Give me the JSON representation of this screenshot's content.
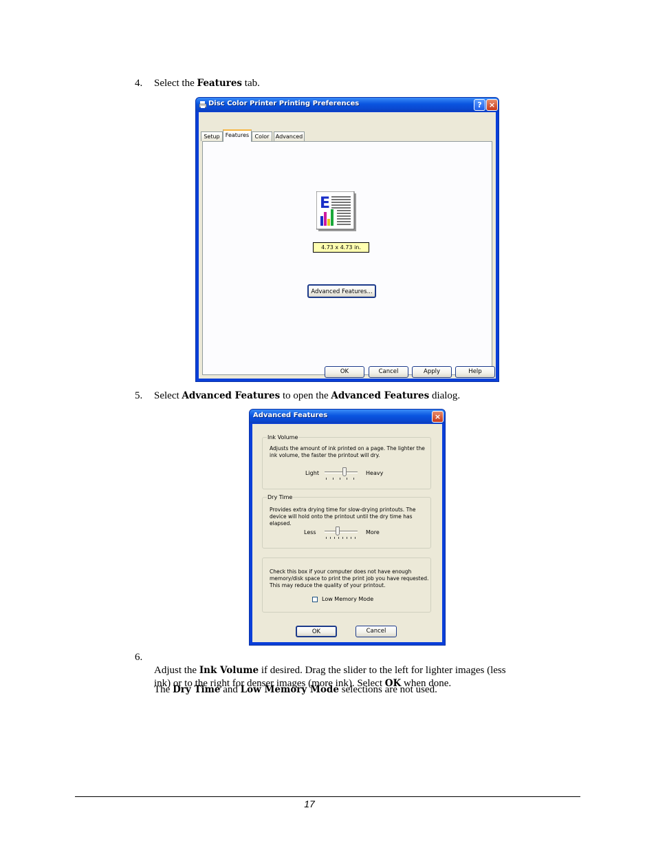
{
  "steps": {
    "s4": {
      "num": "4.",
      "pre": "Select the ",
      "bold": "Features",
      "post": " tab."
    },
    "s5": {
      "num": "5.",
      "pre": "Select ",
      "bold1": "Advanced Features",
      "mid": " to open the ",
      "bold2": "Advanced Features",
      "post": " dialog."
    },
    "s6": {
      "num": "6.",
      "pre": "Adjust the ",
      "bold1": "Ink Volume",
      "mid": " if desired. Drag the slider to the left for lighter images (less",
      "line2": "ink) or to the right for denser images (more ink).  Select ",
      "bold2": "OK",
      "post": " when done."
    },
    "note": {
      "pre": "The ",
      "bold1": "Dry Time",
      "mid": " and ",
      "bold2": "Low Memory Mode",
      "post": " selections are not used."
    }
  },
  "prefs_dialog": {
    "title": "Disc Color Printer Printing Preferences",
    "help_glyph": "?",
    "close_glyph": "×",
    "tabs": [
      "Setup",
      "Features",
      "Color",
      "Advanced"
    ],
    "size_label": "4.73 x 4.73 in.",
    "advanced_button": "Advanced Features...",
    "buttons": {
      "ok": "OK",
      "cancel": "Cancel",
      "apply": "Apply",
      "help": "Help"
    }
  },
  "advanced_dialog": {
    "title": "Advanced Features",
    "close_glyph": "×",
    "ink_volume": {
      "legend": "Ink Volume",
      "description": "Adjusts the amount of ink printed on a page. The lighter the ink volume, the faster the printout will dry.",
      "min_label": "Light",
      "max_label": "Heavy",
      "value_fraction": 0.6
    },
    "dry_time": {
      "legend": "Dry Time",
      "description": "Provides extra drying time for slow-drying printouts. The device will hold onto the printout until the dry time has elapsed.",
      "min_label": "Less",
      "max_label": "More",
      "value_fraction": 0.4
    },
    "memory": {
      "description": "Check this box if your computer does not have enough memory/disk space to print the print job you have requested. This may reduce the quality of your printout.",
      "checkbox_label": "Low Memory Mode",
      "checked": false
    },
    "buttons": {
      "ok": "OK",
      "cancel": "Cancel"
    }
  },
  "footer": {
    "page_number": "17"
  }
}
